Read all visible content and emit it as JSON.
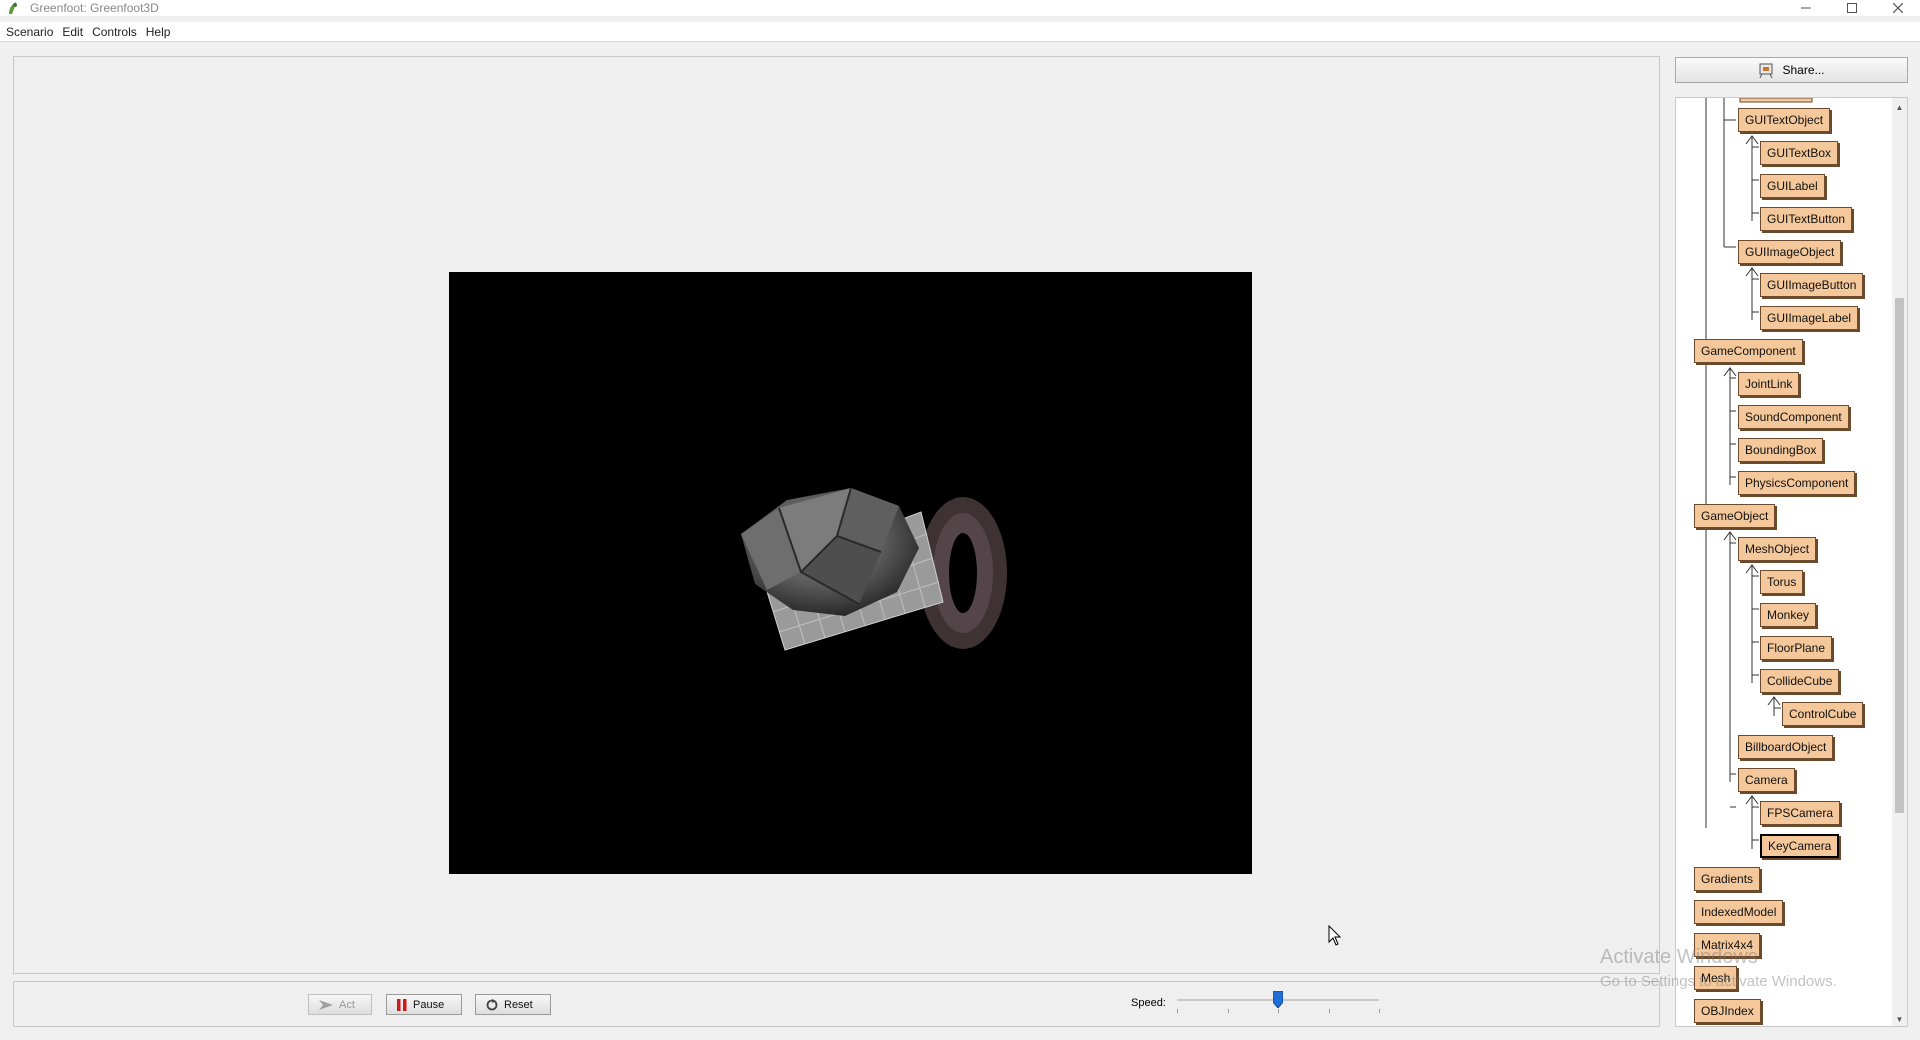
{
  "window": {
    "title": "Greenfoot: Greenfoot3D",
    "minimize_icon": "minimize-icon",
    "maximize_icon": "maximize-icon",
    "close_icon": "close-icon"
  },
  "menu": [
    "Scenario",
    "Edit",
    "Controls",
    "Help"
  ],
  "share": {
    "label": "Share...",
    "icon": "share-icon"
  },
  "controls": {
    "act_label": "Act",
    "pause_label": "Pause",
    "reset_label": "Reset",
    "speed_label": "Speed:",
    "speed_value": 0.5
  },
  "classes": [
    "GUITextObject",
    "GUITextBox",
    "GUILabel",
    "GUITextButton",
    "GUIImageObject",
    "GUIImageButton",
    "GUIImageLabel",
    "GameComponent",
    "JointLink",
    "SoundComponent",
    "BoundingBox",
    "PhysicsComponent",
    "GameObject",
    "MeshObject",
    "Torus",
    "Monkey",
    "FloorPlane",
    "CollideCube",
    "ControlCube",
    "BillboardObject",
    "Camera",
    "FPSCamera",
    "KeyCamera",
    "Gradients",
    "IndexedModel",
    "Matrix4x4",
    "Mesh",
    "OBJIndex"
  ],
  "selected_class": "KeyCamera",
  "watermark": {
    "line1": "Activate Windows",
    "line2": "Go to Settings to activate Windows."
  },
  "colors": {
    "class_fill": "#f5c89b",
    "world_bg": "#000000",
    "slider_thumb": "#1f6fd6"
  }
}
